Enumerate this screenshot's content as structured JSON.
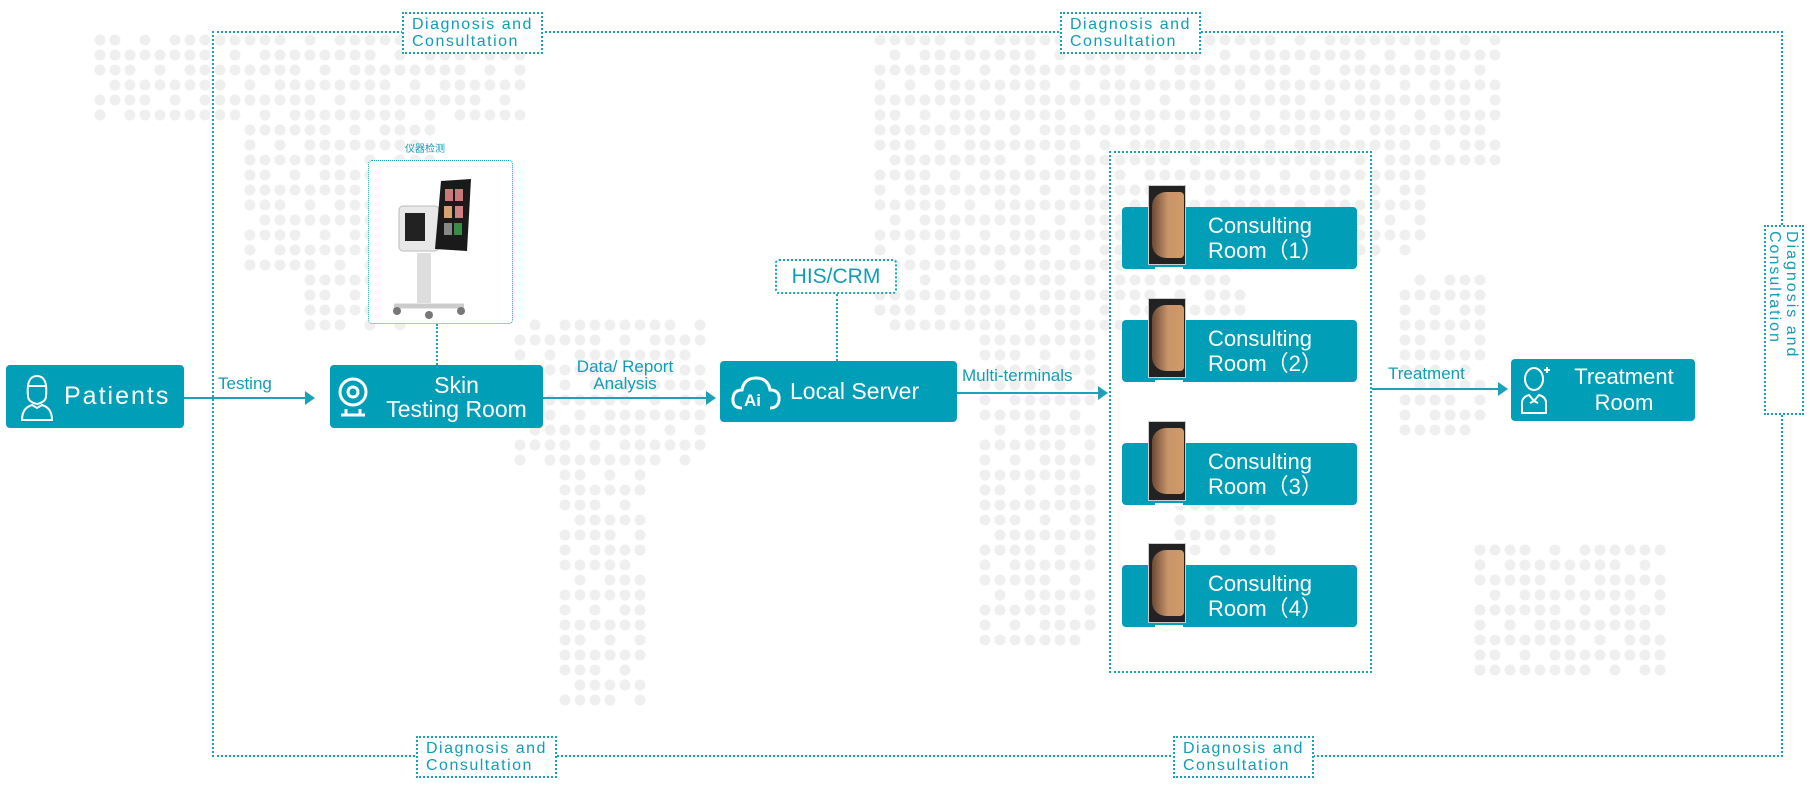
{
  "frame_labels": {
    "top_left": "Diagnosis and\nConsultation",
    "top_right": "Diagnosis and\nConsultation",
    "bottom_left": "Diagnosis and\nConsultation",
    "bottom_right": "Diagnosis and\nConsultation",
    "right": "Diagnosis and\nConsultation"
  },
  "nodes": {
    "patients": "Patients",
    "skin_testing": "Skin\nTesting Room",
    "local_server": "Local Server",
    "his_crm": "HIS/CRM",
    "treatment_room": "Treatment\nRoom",
    "device_caption": "仪器检测",
    "consulting": [
      "Consulting\nRoom（1）",
      "Consulting\nRoom（2）",
      "Consulting\nRoom（3）",
      "Consulting\nRoom（4）"
    ]
  },
  "edges": {
    "testing": "Testing",
    "data_report": "Data/ Report\nAnalysis",
    "multi_terminals": "Multi-terminals",
    "treatment": "Treatment"
  },
  "colors": {
    "accent": "#009fb7",
    "dots": "#efefef"
  }
}
